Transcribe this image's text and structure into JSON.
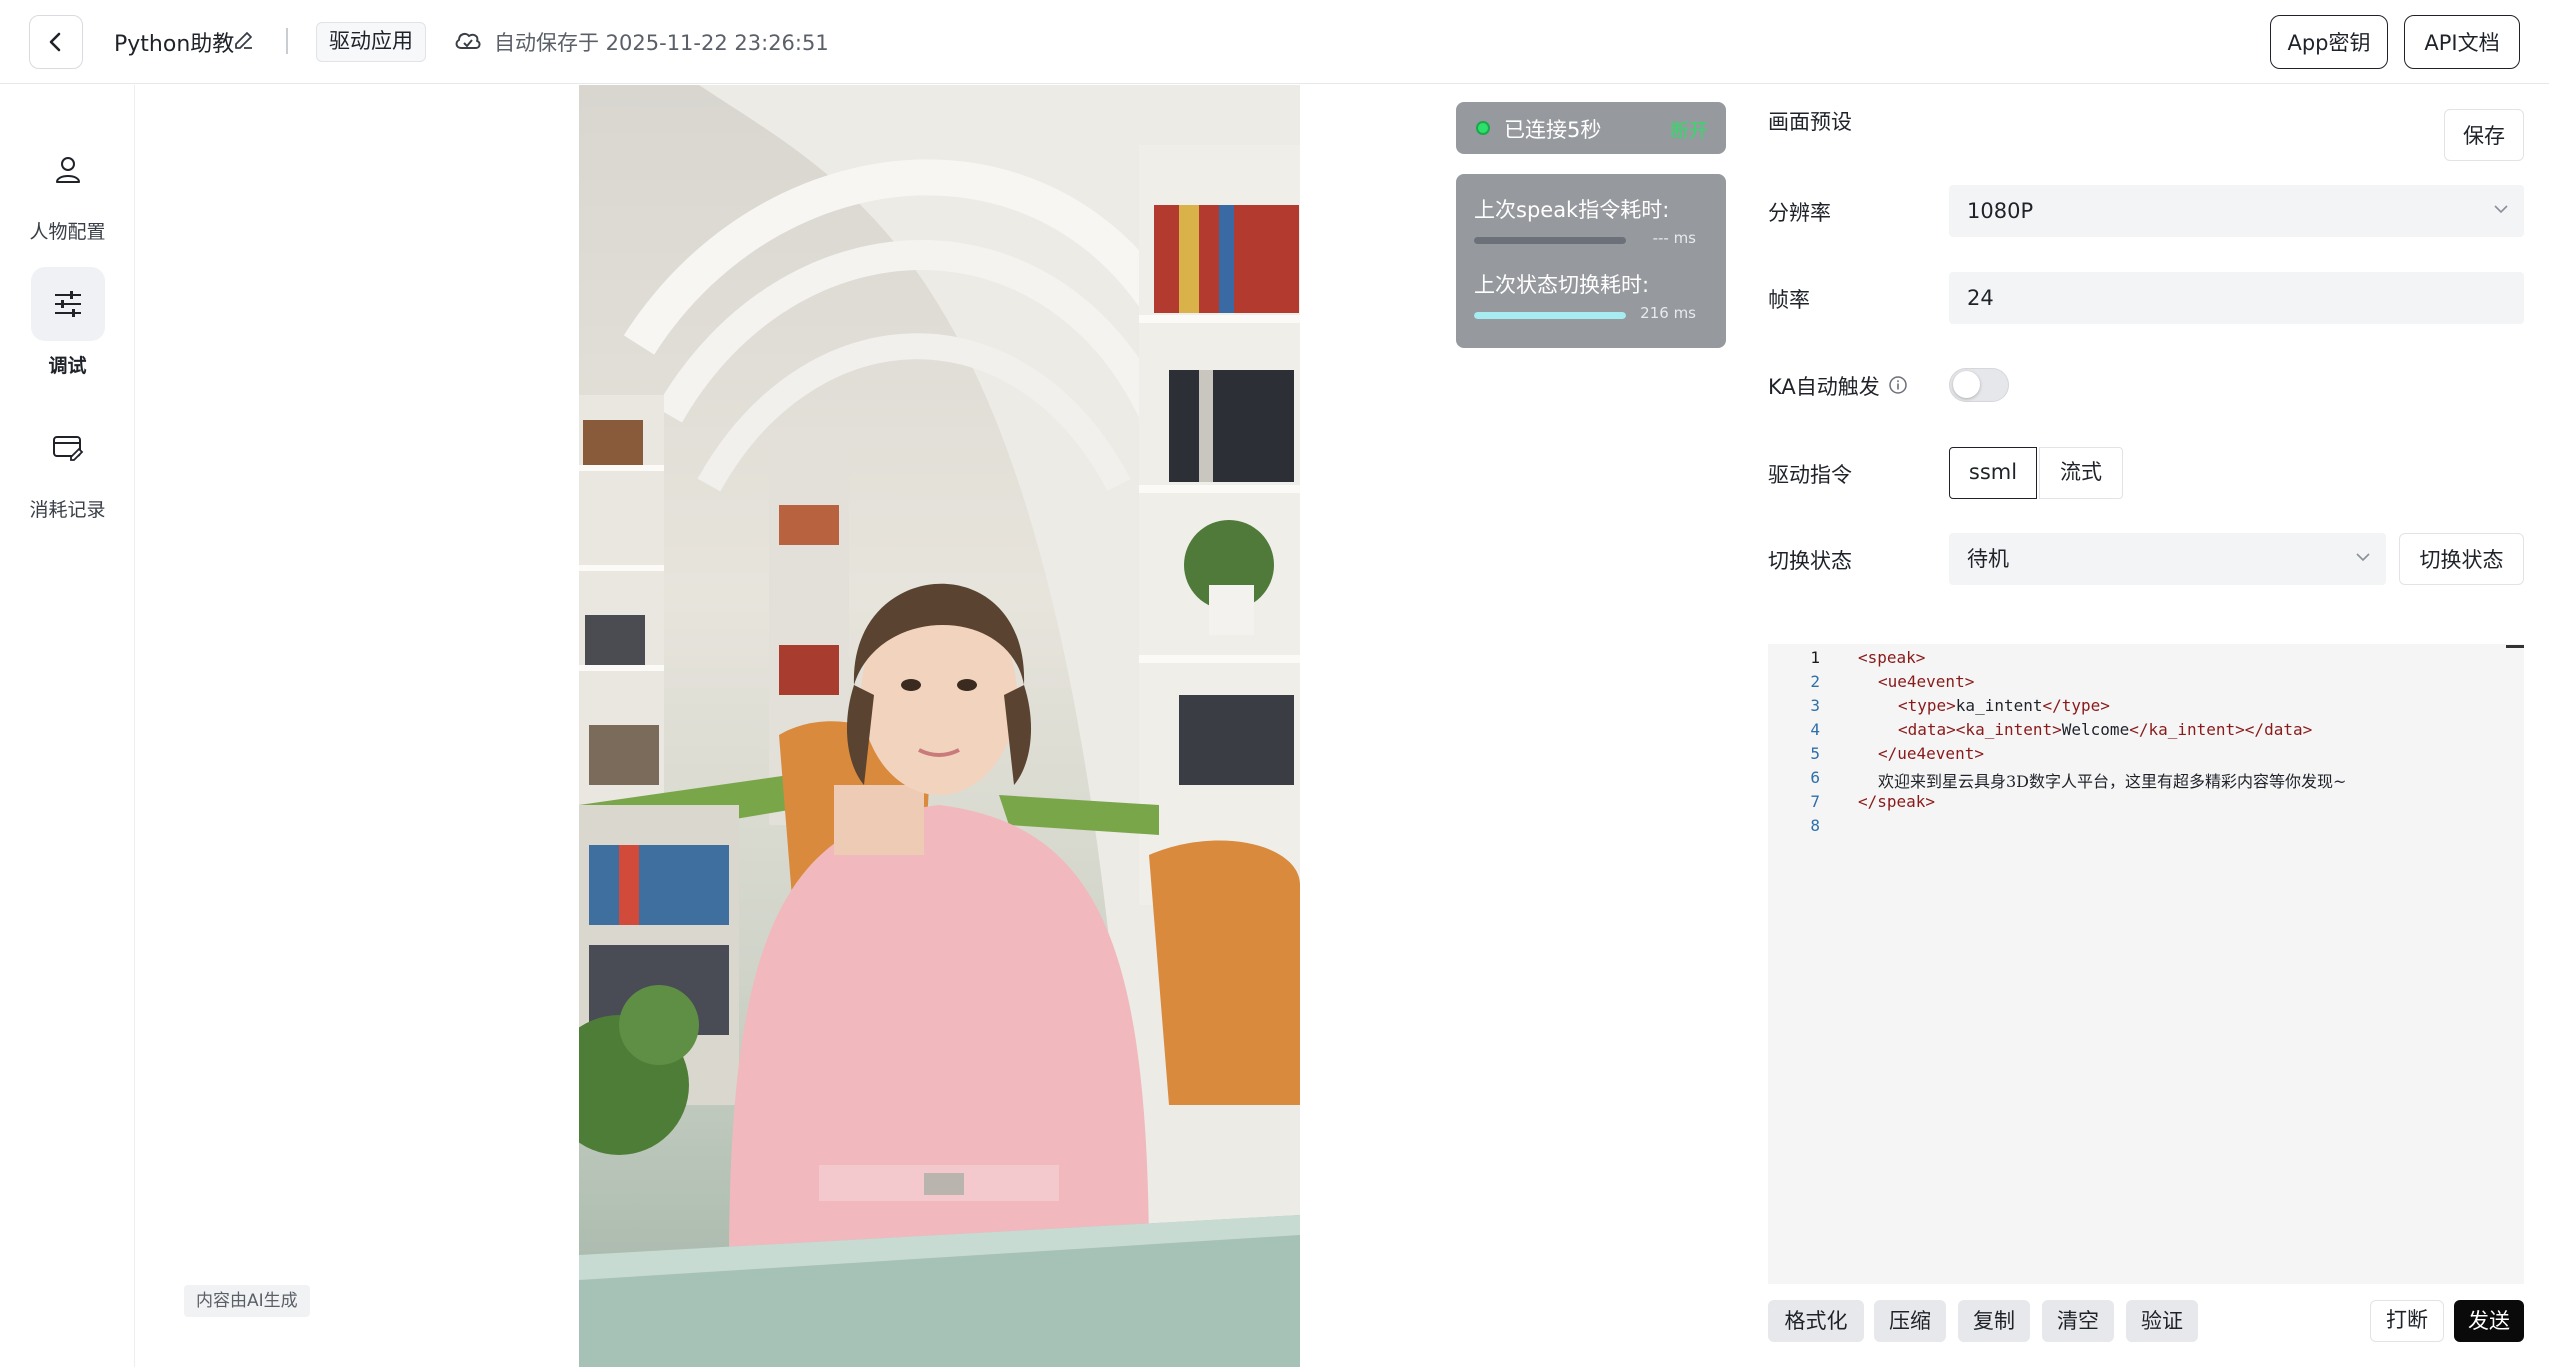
{
  "header": {
    "app_name": "Python助教",
    "mode_tag": "驱动应用",
    "autosave": "自动保存于 2025-11-22 23:26:51",
    "appkey_label": "App密钥",
    "apidoc_label": "API文档"
  },
  "sidebar": {
    "items": [
      {
        "label": "人物配置",
        "icon": "person-icon"
      },
      {
        "label": "调试",
        "icon": "sliders-icon",
        "active": true
      },
      {
        "label": "消耗记录",
        "icon": "card-edit-icon"
      }
    ]
  },
  "stage": {
    "ai_tag": "内容由AI生成",
    "connection": {
      "status": "已连接5秒",
      "action": "断开",
      "dot_color": "#2ee06a"
    },
    "stats": {
      "speak_label": "上次speak指令耗时:",
      "speak_value": "--- ms",
      "speak_progress": 0,
      "state_label": "上次状态切换耗时:",
      "state_value": "216 ms",
      "state_progress": 1.0
    }
  },
  "panel": {
    "title": "画面预设",
    "save_label": "保存",
    "resolution_label": "分辨率",
    "resolution_value": "1080P",
    "fps_label": "帧率",
    "fps_value": "24",
    "ka_label": "KA自动触发",
    "ka_enabled": false,
    "command_label": "驱动指令",
    "command_options": [
      "ssml",
      "流式"
    ],
    "command_selected": "ssml",
    "state_label": "切换状态",
    "state_value": "待机",
    "switch_label": "切换状态"
  },
  "editor": {
    "line_numbers": [
      "1",
      "2",
      "3",
      "4",
      "5",
      "6",
      "7",
      "8"
    ],
    "l1": "<speak>",
    "l2": "<ue4event>",
    "l3_open": "<type>",
    "l3_text": "ka_intent",
    "l3_close": "</type>",
    "l4_open": "<data>",
    "l4_tag": "<ka_intent>",
    "l4_text": "Welcome",
    "l4_tagclose": "</ka_intent>",
    "l4_close": "</data>",
    "l5": "</ue4event>",
    "l6": "欢迎来到星云具身3D数字人平台，这里有超多精彩内容等你发现~",
    "l7": "</speak>"
  },
  "toolbar": {
    "format": "格式化",
    "compress": "压缩",
    "copy": "复制",
    "clear": "清空",
    "validate": "验证",
    "interrupt": "打断",
    "send": "发送"
  },
  "colors": {
    "accent": "#0a0a0a",
    "connected": "#35d96b",
    "progress_fill": "#a7ecf0"
  }
}
